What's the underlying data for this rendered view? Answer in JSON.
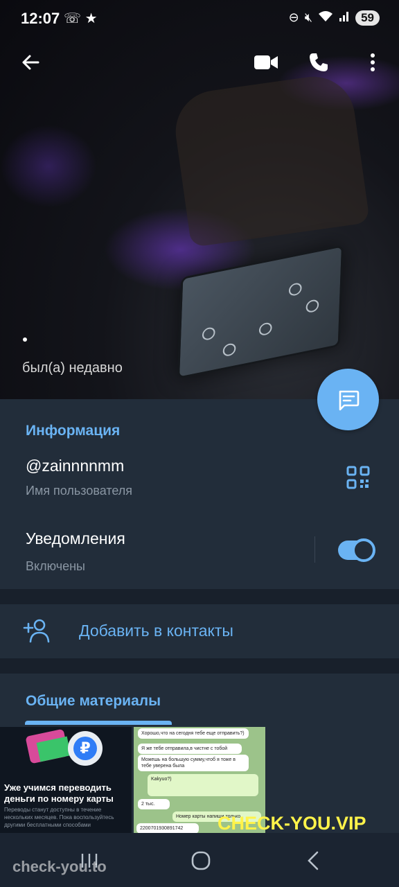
{
  "status_bar": {
    "time": "12:07",
    "battery": "59",
    "left_icons": [
      "missed-call-icon",
      "star-icon"
    ],
    "right_icons": [
      "dnd-icon",
      "mute-icon",
      "wifi-icon",
      "signal-icon"
    ]
  },
  "header": {
    "back_icon": "arrow-left-icon",
    "actions": [
      "video-call-icon",
      "phone-icon",
      "more-vertical-icon"
    ],
    "last_seen": "был(а) недавно"
  },
  "info": {
    "title": "Информация",
    "username": "@zainnnnmm",
    "username_label": "Имя пользователя",
    "notifications_label": "Уведомления",
    "notifications_value": "Включены",
    "notifications_on": true
  },
  "add_contact": {
    "label": "Добавить в контакты"
  },
  "shared": {
    "title": "Общие материалы",
    "media": [
      {
        "title": "Уже учимся переводить деньги по номеру карты",
        "subtitle": "Переводы станут доступны в течение нескольких месяцев. Пока воспользуйтесь другими бесплатными способами"
      },
      {
        "messages": [
          "Хорошо,что на сегодня тебе еще отправить?)",
          "Я же тебе отправила,в чистне с тобой",
          "Можешь на большую сумму,чтоб я тоже в тебе уверена была",
          "Kakyuo?)",
          "2 тыс.",
          "Номер карты напиши только",
          "2200701930891742"
        ]
      }
    ]
  },
  "watermarks": {
    "bottom_left": "check-you.to",
    "bottom_right": "CHECK-YOU.VIP"
  },
  "colors": {
    "accent": "#6ab3f3",
    "panel": "#222d3a",
    "background": "#18202b"
  }
}
